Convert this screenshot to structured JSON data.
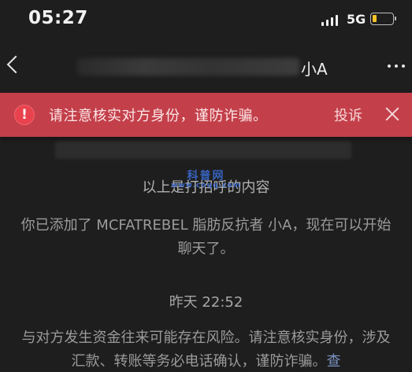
{
  "status_bar": {
    "time": "05:27",
    "network": "5G",
    "battery_level": 0.2,
    "battery_color": "#f6c428"
  },
  "nav": {
    "back_icon": "chevron-left-icon",
    "title_visible": "小A",
    "more_icon": "more-dots-icon"
  },
  "warning": {
    "icon": "exclamation-circle-icon",
    "text": "请注意核实对方身份，谨防诈骗。",
    "report_label": "投诉",
    "close_icon": "close-icon",
    "color": "#c3404a"
  },
  "watermark": {
    "text": "科普网",
    "sub": "www.cnqq.com"
  },
  "messages": {
    "greeting_note": "以上是打招呼的内容",
    "added_note": "你已添加了 MCFATREBEL 脂肪反抗者 小A，现在可以开始聊天了。",
    "timestamp": "昨天 22:52",
    "risk_note": "与对方发生资金往来可能存在风险。请注意核实身份，涉及汇款、转账等务必电话确认，谨防诈骗。",
    "risk_link": "查"
  }
}
